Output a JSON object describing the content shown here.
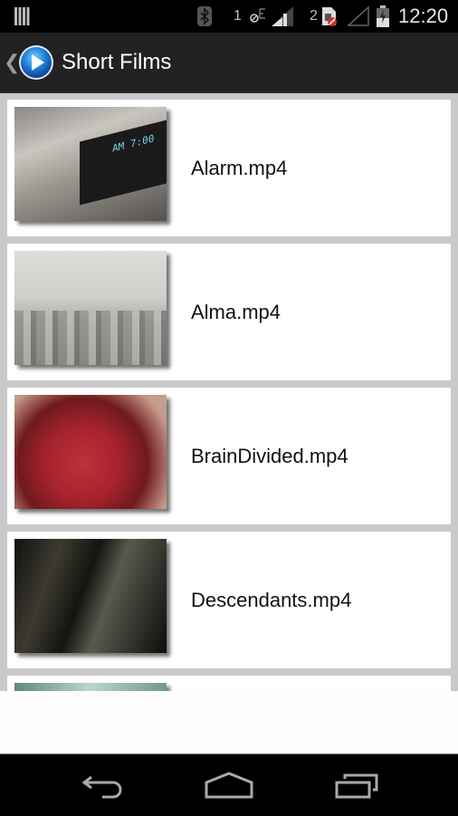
{
  "status_bar": {
    "time": "12:20",
    "sim1_label": "1",
    "sim2_label": "2",
    "icons": [
      "notification-icon",
      "bluetooth-icon",
      "data-blocked-icon",
      "signal-icon",
      "sim-error-icon",
      "no-signal-icon",
      "battery-charging-icon"
    ]
  },
  "action_bar": {
    "title": "Short Films",
    "up_caret": "❮",
    "logo_icon": "play-icon"
  },
  "videos": [
    {
      "name": "Alarm.mp4",
      "thumb": "alarm-clock-closeup"
    },
    {
      "name": "Alma.mp4",
      "thumb": "snowy-town"
    },
    {
      "name": "BrainDivided.mp4",
      "thumb": "red-mask"
    },
    {
      "name": "Descendants.mp4",
      "thumb": "dark-forest"
    },
    {
      "name": "",
      "thumb": "partially-visible"
    }
  ],
  "colors": {
    "action_bar_bg": "#222222",
    "list_bg": "#c9c9c9",
    "item_bg": "#ffffff",
    "logo_blue": "#1e7fd8"
  }
}
